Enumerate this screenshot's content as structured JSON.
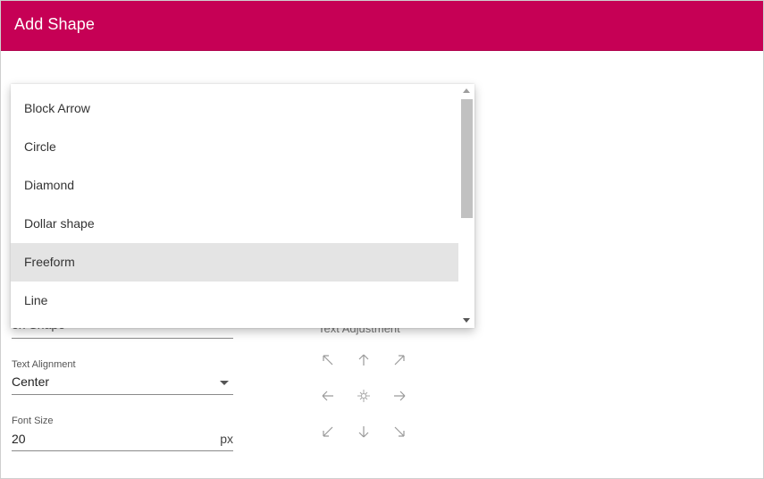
{
  "dialog": {
    "title": "Add Shape",
    "accent_color": "#c60055"
  },
  "form": {
    "shape_field_value": "on Shape",
    "text_alignment": {
      "label": "Text Alignment",
      "value": "Center"
    },
    "font_size": {
      "label": "Font Size",
      "value": "20",
      "unit": "px"
    }
  },
  "text_adjustment": {
    "title": "Text Adjustment",
    "buttons": [
      {
        "name": "top-left",
        "icon": "arrow-up-left-icon"
      },
      {
        "name": "top",
        "icon": "arrow-up-icon"
      },
      {
        "name": "top-right",
        "icon": "arrow-up-right-icon"
      },
      {
        "name": "left",
        "icon": "arrow-left-icon"
      },
      {
        "name": "center",
        "icon": "center-icon"
      },
      {
        "name": "right",
        "icon": "arrow-right-icon"
      },
      {
        "name": "bottom-left",
        "icon": "arrow-down-left-icon"
      },
      {
        "name": "bottom",
        "icon": "arrow-down-icon"
      },
      {
        "name": "bottom-right",
        "icon": "arrow-down-right-icon"
      }
    ]
  },
  "shape_dropdown": {
    "items": [
      "Block Arrow",
      "Circle",
      "Diamond",
      "Dollar shape",
      "Freeform",
      "Line"
    ],
    "highlighted": "Freeform"
  }
}
